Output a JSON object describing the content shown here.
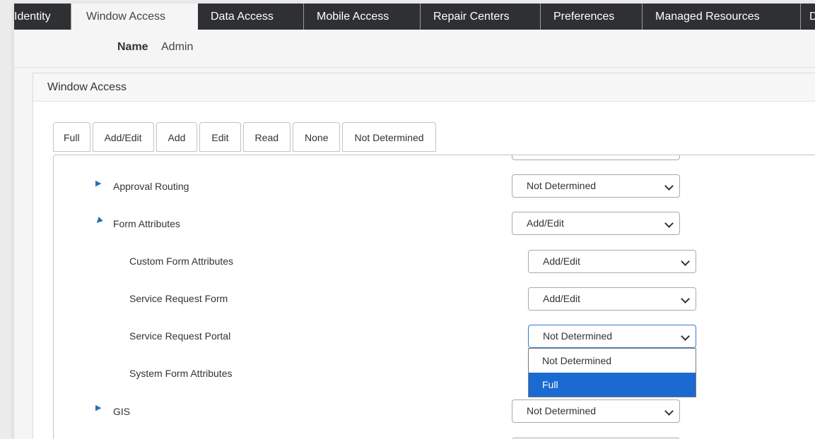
{
  "tabs": [
    "Identity",
    "Window Access",
    "Data Access",
    "Mobile Access",
    "Repair Centers",
    "Preferences",
    "Managed Resources",
    "D"
  ],
  "name_row": {
    "label": "Name",
    "value": "Admin"
  },
  "panel": {
    "title": "Window Access"
  },
  "level_buttons": [
    "Full",
    "Add/Edit",
    "Add",
    "Edit",
    "Read",
    "None",
    "Not Determined"
  ],
  "tree": [
    {
      "label": "Approval Routing",
      "value": "Not Determined",
      "expanded": false
    },
    {
      "label": "Form Attributes",
      "value": "Add/Edit",
      "expanded": true
    },
    {
      "label": "Custom Form Attributes",
      "value": "Add/Edit"
    },
    {
      "label": "Service Request Form",
      "value": "Add/Edit"
    },
    {
      "label": "Service Request Portal",
      "value": "Not Determined"
    },
    {
      "label": "System Form Attributes",
      "value": ""
    },
    {
      "label": "GIS",
      "value": "Not Determined",
      "expanded": false
    }
  ],
  "dropdown_options": [
    "Not Determined",
    "Full"
  ],
  "colors": {
    "tabbar": "#2f3033",
    "accent": "#1a6ad1",
    "expand_icon": "#2b6cb8"
  },
  "icons": {
    "collapsed": "triangle-right-icon",
    "expanded": "triangle-up-left-icon",
    "select": "chevron-down-icon"
  }
}
